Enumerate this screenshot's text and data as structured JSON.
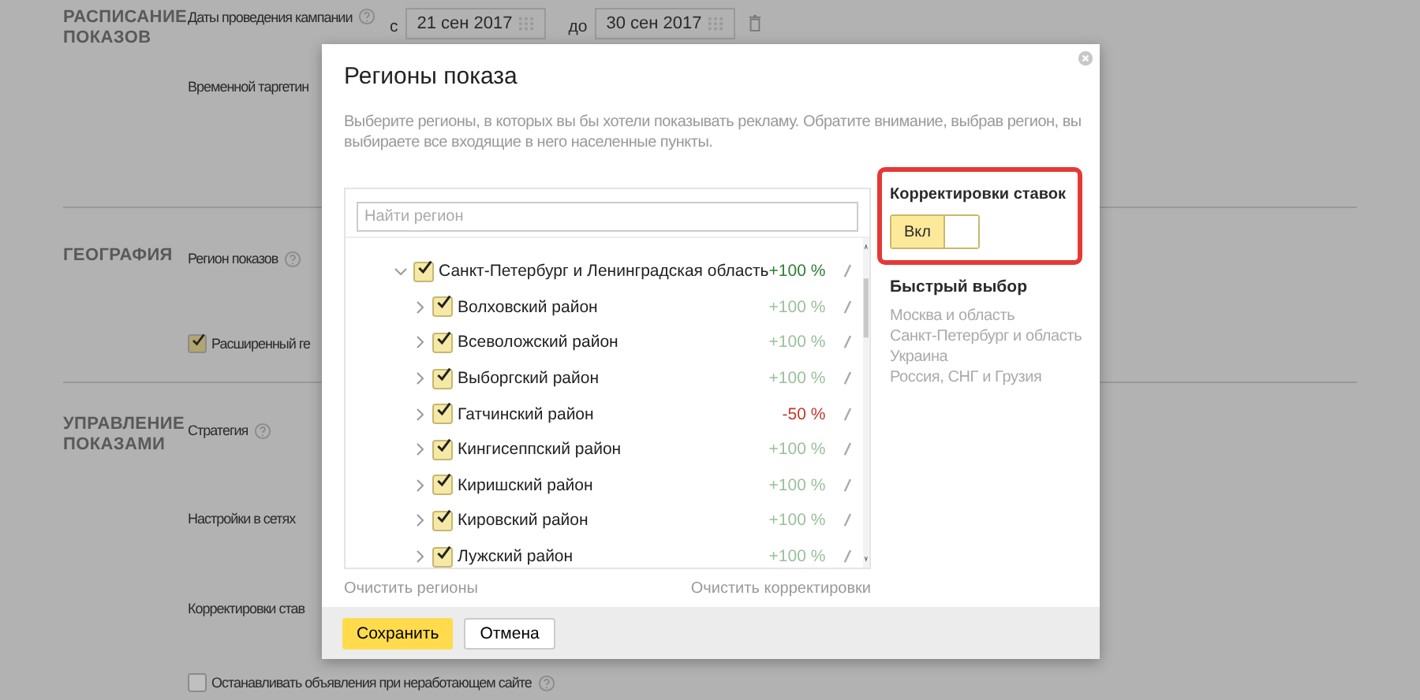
{
  "background": {
    "sections": [
      {
        "title": "РАСПИСАНИЕ ПОКАЗОВ",
        "rows": [
          {
            "kind": "dates",
            "label": "Даты проведения кампании",
            "help": true,
            "from_prefix": "с",
            "from": "21 сен 2017",
            "to_prefix": "до",
            "to": "30 сен 2017"
          },
          {
            "kind": "label",
            "label": "Временной таргетин"
          }
        ]
      },
      {
        "title": "ГЕОГРАФИЯ",
        "rows": [
          {
            "kind": "label",
            "label": "Регион показов",
            "help": true
          },
          {
            "kind": "checkbox",
            "label": "Расширенный ге",
            "checked": true
          }
        ]
      },
      {
        "title": "УПРАВЛЕНИЕ ПОКАЗАМИ",
        "rows": [
          {
            "kind": "label",
            "label": "Стратегия",
            "help": true
          },
          {
            "kind": "label",
            "label": "Настройки в сетях"
          },
          {
            "kind": "label",
            "label": "Корректировки став"
          },
          {
            "kind": "checkbox",
            "label": "Останавливать объявления при неработающем сайте",
            "checked": false,
            "help": true
          }
        ]
      }
    ]
  },
  "dialog": {
    "title": "Регионы показа",
    "description": "Выберите регионы, в которых вы бы хотели показывать рекламу. Обратите внимание, выбрав регион, вы выбираете все входящие в него населенные пункты.",
    "search": {
      "placeholder": "Найти регион"
    },
    "regions": [
      {
        "label": "Санкт-Петербург и Ленинградская область",
        "checked": true,
        "expanded": true,
        "adjustment": "+100 %",
        "color": "#2f7d32",
        "children": [
          {
            "label": "Волховский район",
            "checked": true,
            "expanded": false,
            "adjustment": "+100 %",
            "color": "#9bbf9b"
          },
          {
            "label": "Всеволожский район",
            "checked": true,
            "expanded": false,
            "adjustment": "+100 %",
            "color": "#9bbf9b"
          },
          {
            "label": "Выборгский район",
            "checked": true,
            "expanded": false,
            "adjustment": "+100 %",
            "color": "#9bbf9b"
          },
          {
            "label": "Гатчинский район",
            "checked": true,
            "expanded": false,
            "adjustment": "-50 %",
            "color": "#c0392b"
          },
          {
            "label": "Кингисеппский район",
            "checked": true,
            "expanded": false,
            "adjustment": "+100 %",
            "color": "#9bbf9b"
          },
          {
            "label": "Киришский район",
            "checked": true,
            "expanded": false,
            "adjustment": "+100 %",
            "color": "#9bbf9b"
          },
          {
            "label": "Кировский район",
            "checked": true,
            "expanded": false,
            "adjustment": "+100 %",
            "color": "#9bbf9b"
          },
          {
            "label": "Лужский район",
            "checked": true,
            "expanded": false,
            "adjustment": "+100 %",
            "color": "#9bbf9b"
          }
        ]
      }
    ],
    "clear_regions": "Очистить регионы",
    "clear_adjustments": "Очистить корректировки",
    "bid_adjustments": {
      "title": "Корректировки ставок",
      "toggle_label": "Вкл",
      "on": true
    },
    "quick_select": {
      "title": "Быстрый выбор",
      "items": [
        "Москва и область",
        "Санкт-Петербург и область",
        "Украина",
        "Россия, СНГ и Грузия"
      ]
    },
    "buttons": [
      {
        "label": "Сохранить",
        "kind": "primary"
      },
      {
        "label": "Отмена",
        "kind": "secondary"
      }
    ]
  }
}
